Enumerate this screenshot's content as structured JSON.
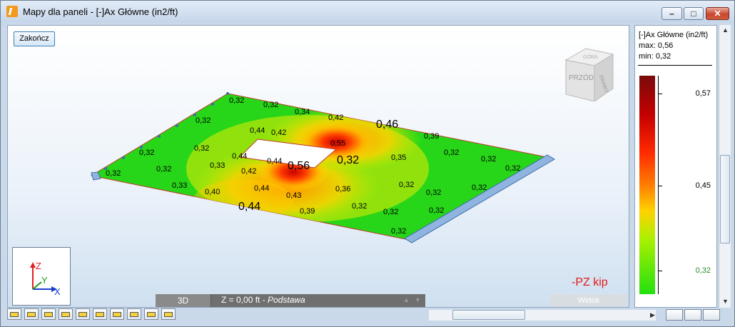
{
  "window": {
    "title": "Mapy dla paneli - [-]Ax Główne (in2/ft)",
    "min_glyph": "–",
    "max_glyph": "□",
    "close_glyph": "✕"
  },
  "viewport": {
    "finish_button": "Zakończ",
    "view_cube_front": "PRZÓD",
    "view_cube_right": "PRAWY",
    "view_cube_top": "GÓRA",
    "axis_labels": {
      "z": "Z",
      "y": "Y",
      "x": "X"
    },
    "load_label": "-PZ kip",
    "mode_button": "3D",
    "level_prefix": "Z = 0,00 ft - ",
    "level_name": "Podstawa",
    "view_label": "Widok",
    "contour_values": [
      {
        "t": "0,32"
      },
      {
        "t": "0,32"
      },
      {
        "t": "0,34"
      },
      {
        "t": "0,42"
      },
      {
        "t": "0,46"
      },
      {
        "t": "0,39"
      },
      {
        "t": "0,32"
      },
      {
        "t": "0,32"
      },
      {
        "t": "0,42"
      },
      {
        "t": "0,44"
      },
      {
        "t": "0,55"
      },
      {
        "t": "0,32"
      },
      {
        "t": "0,32"
      },
      {
        "t": "0,35"
      },
      {
        "t": "0,32"
      },
      {
        "t": "0,32"
      },
      {
        "t": "0,32"
      },
      {
        "t": "0,44"
      },
      {
        "t": "0,44"
      },
      {
        "t": "0,56"
      },
      {
        "t": "0,32"
      },
      {
        "t": "0,32"
      },
      {
        "t": "0,33"
      },
      {
        "t": "0,42"
      },
      {
        "t": "0,32"
      },
      {
        "t": "0,33"
      },
      {
        "t": "0,40"
      },
      {
        "t": "0,44"
      },
      {
        "t": "0,43"
      },
      {
        "t": "0,36"
      },
      {
        "t": "0,32"
      },
      {
        "t": "0,32"
      },
      {
        "t": "0,32"
      },
      {
        "t": "0,44"
      },
      {
        "t": "0,39"
      },
      {
        "t": "0,32"
      },
      {
        "t": "0,32"
      },
      {
        "t": "0,32"
      },
      {
        "t": "0,32"
      }
    ]
  },
  "legend": {
    "title": "[-]Ax Główne (in2/ft)",
    "max": "max: 0,56",
    "min": "min: 0,32",
    "ticks": [
      "0,57",
      "0,45",
      "0,32"
    ]
  },
  "colors": {
    "legend_min_label": "#2e8b2e",
    "load_label": "#e31b1b"
  }
}
